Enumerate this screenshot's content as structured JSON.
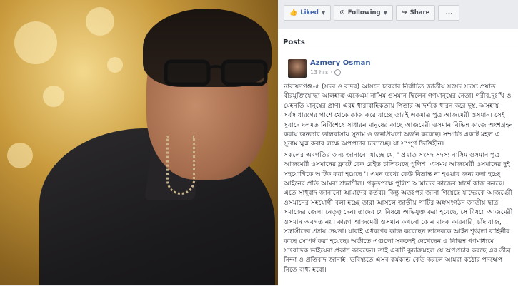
{
  "toolbar": {
    "liked_label": "Liked",
    "following_label": "Following",
    "share_label": "Share",
    "more_label": "..."
  },
  "panel": {
    "title": "Posts"
  },
  "post": {
    "author": "Azmery Osman",
    "time": "13 hrs",
    "paragraph1": "নারায়ণগঞ্জ-৫ (সদর ও বন্দর) আসনে চারবার নির্বাচিত জাতীয় সংসদ সদস্য প্রয়াত বীরমুক্তিযোদ্ধা আলহাজ্ব একেএম নাসিম ওসমান ছিলেন গণমানুষের নেতা। গরীব,দুঃখি ও মেহনতি মানুষের প্রাণ। এরই ধারাবাহিকতায় পিতার আদর্শকে ধারন করে দুস্থ, অসহায় সর্বসাধারণের পাশে থেকে কাজ করে যাচ্ছে তারই একমাত্র পুত্র আজমেরী ওসমান। সেই সুবাদে দলমত নির্বিশেষে সাধারন মানুষের কাছে আজমেরী ওসমান বিভিন্ন কাজে অংশগ্রহন করায় জনতার ভালবাসায় সুনাম ও জনপ্রিয়তা অর্জন করেছে। সম্প্রতি একটি মহল এ সুনাম ক্ষুন্ন করার লক্ষে অপপ্রচার চালাচ্ছে। যা সম্পূর্ণ ভিত্তিহীন।",
    "paragraph2": "সকলের অবগতির জন্য জানানো যাচ্ছে যে, ' প্রয়াত সংসদ সদস্য নাসিম ওসমান পুত্র আজমেরী ওসমানের ফ্লাটে রেক রেইড চালিয়েছে পুলিশ। এসময় আজমেরী ওসমানের দুই সহযোগিকে আটক করা হয়েছে '। এমন তথ্যে কেউ বিভ্রান্ত না হওয়ার জন্য বলা হচ্ছে।আইনের প্রতি আমরা শ্রদ্ধাশীল। প্রকৃতপক্ষে পুলিশ আমাদের কাজের স্বার্থে কাজ করছে। এতে সাধুবাদ জানানো আমাদের কর্তব্য। কিন্তু অতঃপর জানা গিয়েছে যাদেরকে আজমেরী ওসমানের সহযোগী বলা হচ্ছে তারা আসলে জাতীয় পার্টির অঙ্গসংগঠন জাতীয় ছাত্র সমাজের জেলা নেতৃত্ব দেন। তাদের যে বিষয়ে অভিযুক্ত করা হয়েছে, সে বিষয়ে আজমেরী ওসমান অবগত নয়। কারণ আজমেরী ওসমান কখনো কোন মাদক কারবারি, চাঁদাবাজ, সন্ত্রাসীদের প্রশ্রয় দেয়না। যারাই এধরণের কাজ করেছেন তাদেরকে আইন শৃঙ্খলা বাহিনীর কাছে সোপর্দ করা হয়েছে। অতীতে এগুলো সকলেই দেখেছেন ও বিভিন্ন গণমাধ্যমে সাংবাদিক ভাইয়েরা প্রকাশ করেছেন। তাই একটি কুচক্রিমহল যে অপপ্রচার করছে এর তীব্র নিন্দা ও প্রতিবাদ জানাই। ভবিষ্যতে এসব কর্মকান্ড কেউ করলে আমরা কঠোর পদক্ষেপ নিতে বাধ্য হবো।"
  }
}
